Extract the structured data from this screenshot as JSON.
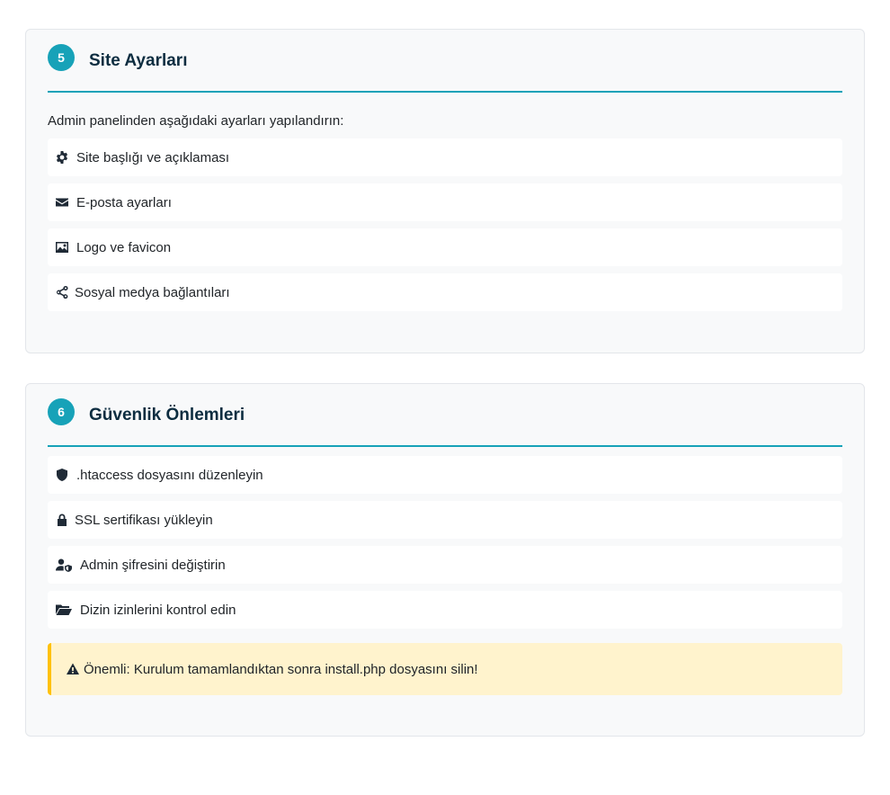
{
  "site_settings": {
    "step": "5",
    "title": "Site Ayarları",
    "intro": "Admin panelinden aşağıdaki ayarları yapılandırın:",
    "items": [
      {
        "icon": "gear-icon",
        "label": "Site başlığı ve açıklaması"
      },
      {
        "icon": "envelope-icon",
        "label": "E-posta ayarları"
      },
      {
        "icon": "image-icon",
        "label": "Logo ve favicon"
      },
      {
        "icon": "share-icon",
        "label": "Sosyal medya bağlantıları"
      }
    ]
  },
  "security": {
    "step": "6",
    "title": "Güvenlik Önlemleri",
    "items": [
      {
        "icon": "shield-icon",
        "label": ".htaccess dosyasını düzenleyin"
      },
      {
        "icon": "lock-icon",
        "label": "SSL sertifikası yükleyin"
      },
      {
        "icon": "user-shield-icon",
        "label": "Admin şifresini değiştirin"
      },
      {
        "icon": "folder-open-icon",
        "label": "Dizin izinlerini kontrol edin"
      }
    ],
    "warning": {
      "icon": "warning-icon",
      "text": "Önemli: Kurulum tamamlandıktan sonra install.php dosyasını silin!"
    }
  },
  "colors": {
    "accent": "#17a2b8",
    "title": "#0d2d40",
    "card_bg": "#f8f9fa",
    "warning_bg": "#fff3cd",
    "warning_border": "#ffc107"
  }
}
